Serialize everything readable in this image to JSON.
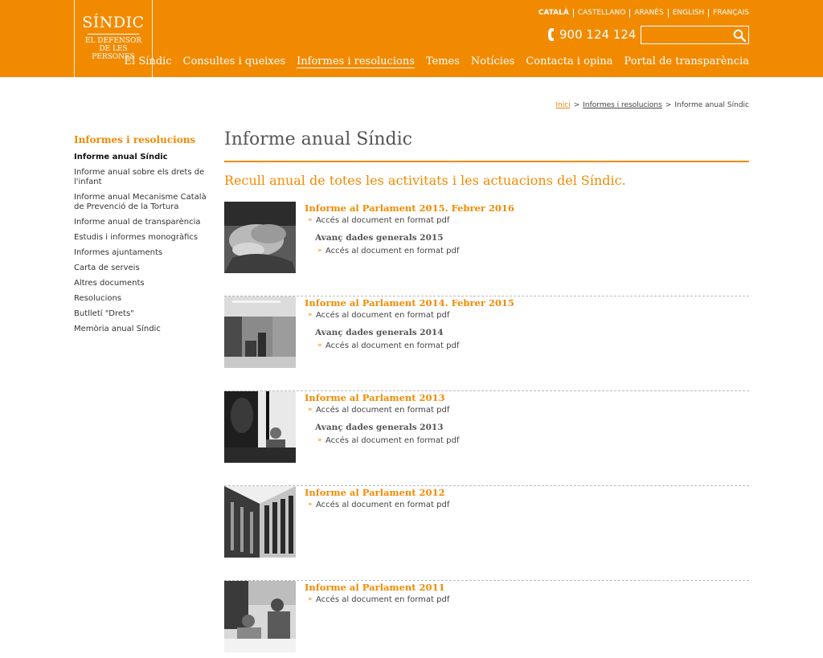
{
  "logo": {
    "title": "SÍNDIC",
    "subtitle_lines": [
      "EL DEFENSOR",
      "DE LES",
      "PERSONES"
    ]
  },
  "languages": [
    {
      "label": "CATALÀ",
      "active": true
    },
    {
      "label": "CASTELLANO",
      "active": false
    },
    {
      "label": "ARANÈS",
      "active": false
    },
    {
      "label": "ENGLISH",
      "active": false
    },
    {
      "label": "FRANÇAIS",
      "active": false
    }
  ],
  "phone": "900 124 124",
  "search": {
    "value": "",
    "placeholder": ""
  },
  "nav": [
    {
      "label": "El Síndic",
      "current": false
    },
    {
      "label": "Consultes i queixes",
      "current": false
    },
    {
      "label": "Informes i resolucions",
      "current": true
    },
    {
      "label": "Temes",
      "current": false
    },
    {
      "label": "Notícies",
      "current": false
    },
    {
      "label": "Contacta i opina",
      "current": false
    },
    {
      "label": "Portal de transparència",
      "current": false
    }
  ],
  "breadcrumb": {
    "home": "Inici",
    "section": "Informes i resolucions",
    "current": "Informe anual Síndic",
    "separator": ">"
  },
  "sidebar": {
    "title": "Informes i resolucions",
    "items": [
      {
        "label": "Informe anual Síndic",
        "active": true
      },
      {
        "label": "Informe anual sobre els drets de l'infant",
        "active": false
      },
      {
        "label": "Informe anual Mecanisme Català de Prevenció de la Tortura",
        "active": false
      },
      {
        "label": "Informe anual de transparència",
        "active": false
      },
      {
        "label": "Estudis i informes monogràfics",
        "active": false
      },
      {
        "label": "Informes ajuntaments",
        "active": false
      },
      {
        "label": "Carta de serveis",
        "active": false
      },
      {
        "label": "Altres documents",
        "active": false
      },
      {
        "label": "Resolucions",
        "active": false
      },
      {
        "label": "Butlletí \"Drets\"",
        "active": false
      },
      {
        "label": "Memòria anual Síndic",
        "active": false
      }
    ]
  },
  "main": {
    "title": "Informe anual Síndic",
    "subtitle": "Recull anual de totes les activitats i les actuacions del Síndic.",
    "link_chevron": "»",
    "reports": [
      {
        "title": "Informe al Parlament 2015. Febrer 2016",
        "link": "Accés al document en format pdf",
        "sub_title": "Avanç dades generals 2015",
        "sub_link": "Accés al document en format pdf"
      },
      {
        "title": "Informe al Parlament 2014. Febrer 2015",
        "link": "Accés al document en format pdf",
        "sub_title": "Avanç dades generals 2014",
        "sub_link": "Accés al document en format pdf"
      },
      {
        "title": "Informe al Parlament 2013",
        "link": "Accés al document en format pdf",
        "sub_title": "Avanç dades generals 2013",
        "sub_link": "Accés al document en format pdf"
      },
      {
        "title": "Informe al Parlament 2012",
        "link": "Accés al document en format pdf"
      },
      {
        "title": "Informe al Parlament 2011",
        "link": "Accés al document en format pdf"
      }
    ]
  },
  "colors": {
    "brand": "#f28a00",
    "text": "#333333"
  }
}
